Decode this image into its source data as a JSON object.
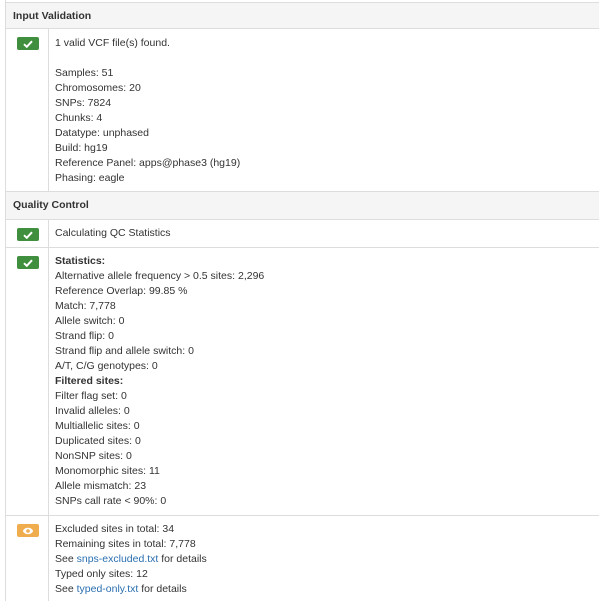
{
  "input_validation": {
    "header": "Input Validation",
    "lines": [
      "1 valid VCF file(s) found.",
      "Samples: 51",
      "Chromosomes: 20",
      "SNPs: 7824",
      "Chunks: 4",
      "Datatype: unphased",
      "Build: hg19",
      "Reference Panel: apps@phase3 (hg19)",
      "Phasing: eagle"
    ],
    "status_icon": "check-icon",
    "status_color": "#3f8f3f"
  },
  "quality_control": {
    "header": "Quality Control",
    "calc_line": "Calculating QC Statistics",
    "statistics": {
      "title": "Statistics:",
      "lines": [
        "Alternative allele frequency > 0.5 sites: 2,296",
        "Reference Overlap: 99.85 %",
        "Match: 7,778",
        "Allele switch: 0",
        "Strand flip: 0",
        "Strand flip and allele switch: 0",
        "A/T, C/G genotypes: 0"
      ],
      "filtered_title": "Filtered sites:",
      "filtered_lines": [
        "Filter flag set: 0",
        "Invalid alleles: 0",
        "Multiallelic sites: 0",
        "Duplicated sites: 0",
        "NonSNP sites: 0",
        "Monomorphic sites: 11",
        "Allele mismatch: 23",
        "SNPs call rate < 90%: 0"
      ]
    },
    "summary": {
      "status_icon": "eye-icon",
      "status_color": "#f0ad4e",
      "excluded": "Excluded sites in total: 34",
      "remaining": "Remaining sites in total: 7,778",
      "see1_prefix": "See ",
      "see1_link": "snps-excluded.txt",
      "see1_suffix": " for details",
      "typed_only": "Typed only sites: 12",
      "see2_prefix": "See ",
      "see2_link": "typed-only.txt",
      "see2_suffix": " for details"
    }
  }
}
